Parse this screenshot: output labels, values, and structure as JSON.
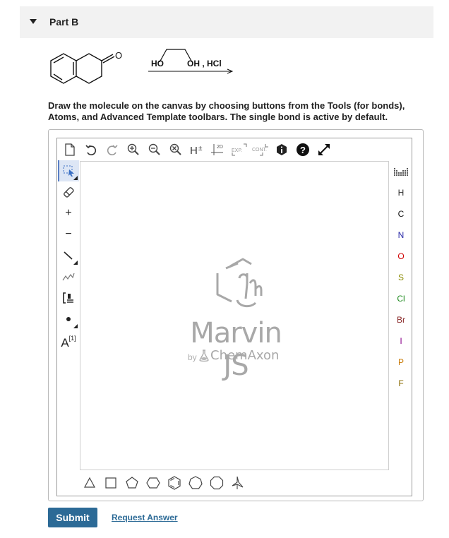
{
  "part": {
    "title": "Part B"
  },
  "reaction": {
    "reagent_left": "HO",
    "reagent_right": "OH , HCl",
    "ketone_oxygen": "O"
  },
  "instructions": "Draw the molecule on the canvas by choosing buttons from the Tools (for bonds), Atoms, and Advanced Template toolbars. The single bond is active by default.",
  "top_toolbar": [
    "new-document-icon",
    "undo-icon",
    "redo-icon",
    "zoom-in-icon",
    "zoom-out-icon",
    "zoom-reset-icon",
    "hydrogen-toggle-icon",
    "clean-2d-icon",
    "expand-icon",
    "contract-icon",
    "info-icon",
    "help-icon",
    "fullscreen-icon"
  ],
  "left_toolbar": {
    "charge_plus": "+",
    "charge_minus": "−",
    "atom_map_label": "A",
    "atom_map_index": "[1]"
  },
  "brand": {
    "title": "Marvin JS",
    "by": "by",
    "company": "ChemAxon"
  },
  "right_toolbar": {
    "periodic_table": "periodic-table-icon",
    "atoms": [
      {
        "symbol": "H",
        "color": "#333333"
      },
      {
        "symbol": "C",
        "color": "#111111"
      },
      {
        "symbol": "N",
        "color": "#2a2aa8"
      },
      {
        "symbol": "O",
        "color": "#d00000"
      },
      {
        "symbol": "S",
        "color": "#8a8a00"
      },
      {
        "symbol": "Cl",
        "color": "#1e8a1e"
      },
      {
        "symbol": "Br",
        "color": "#8a2a2a"
      },
      {
        "symbol": "I",
        "color": "#8a008a"
      },
      {
        "symbol": "P",
        "color": "#c87800"
      },
      {
        "symbol": "F",
        "color": "#8a6a00"
      }
    ]
  },
  "bottom_toolbar": [
    "triangle-template-icon",
    "square-template-icon",
    "pentagon-template-icon",
    "hexagon-template-icon",
    "benzene-template-icon",
    "heptagon-template-icon",
    "octagon-template-icon",
    "chair-template-icon"
  ],
  "actions": {
    "submit": "Submit",
    "request": "Request Answer"
  },
  "colors": {
    "accent": "#2c6a96",
    "header_bg": "#f2f2f2",
    "selection_bg": "#dde6f5"
  }
}
